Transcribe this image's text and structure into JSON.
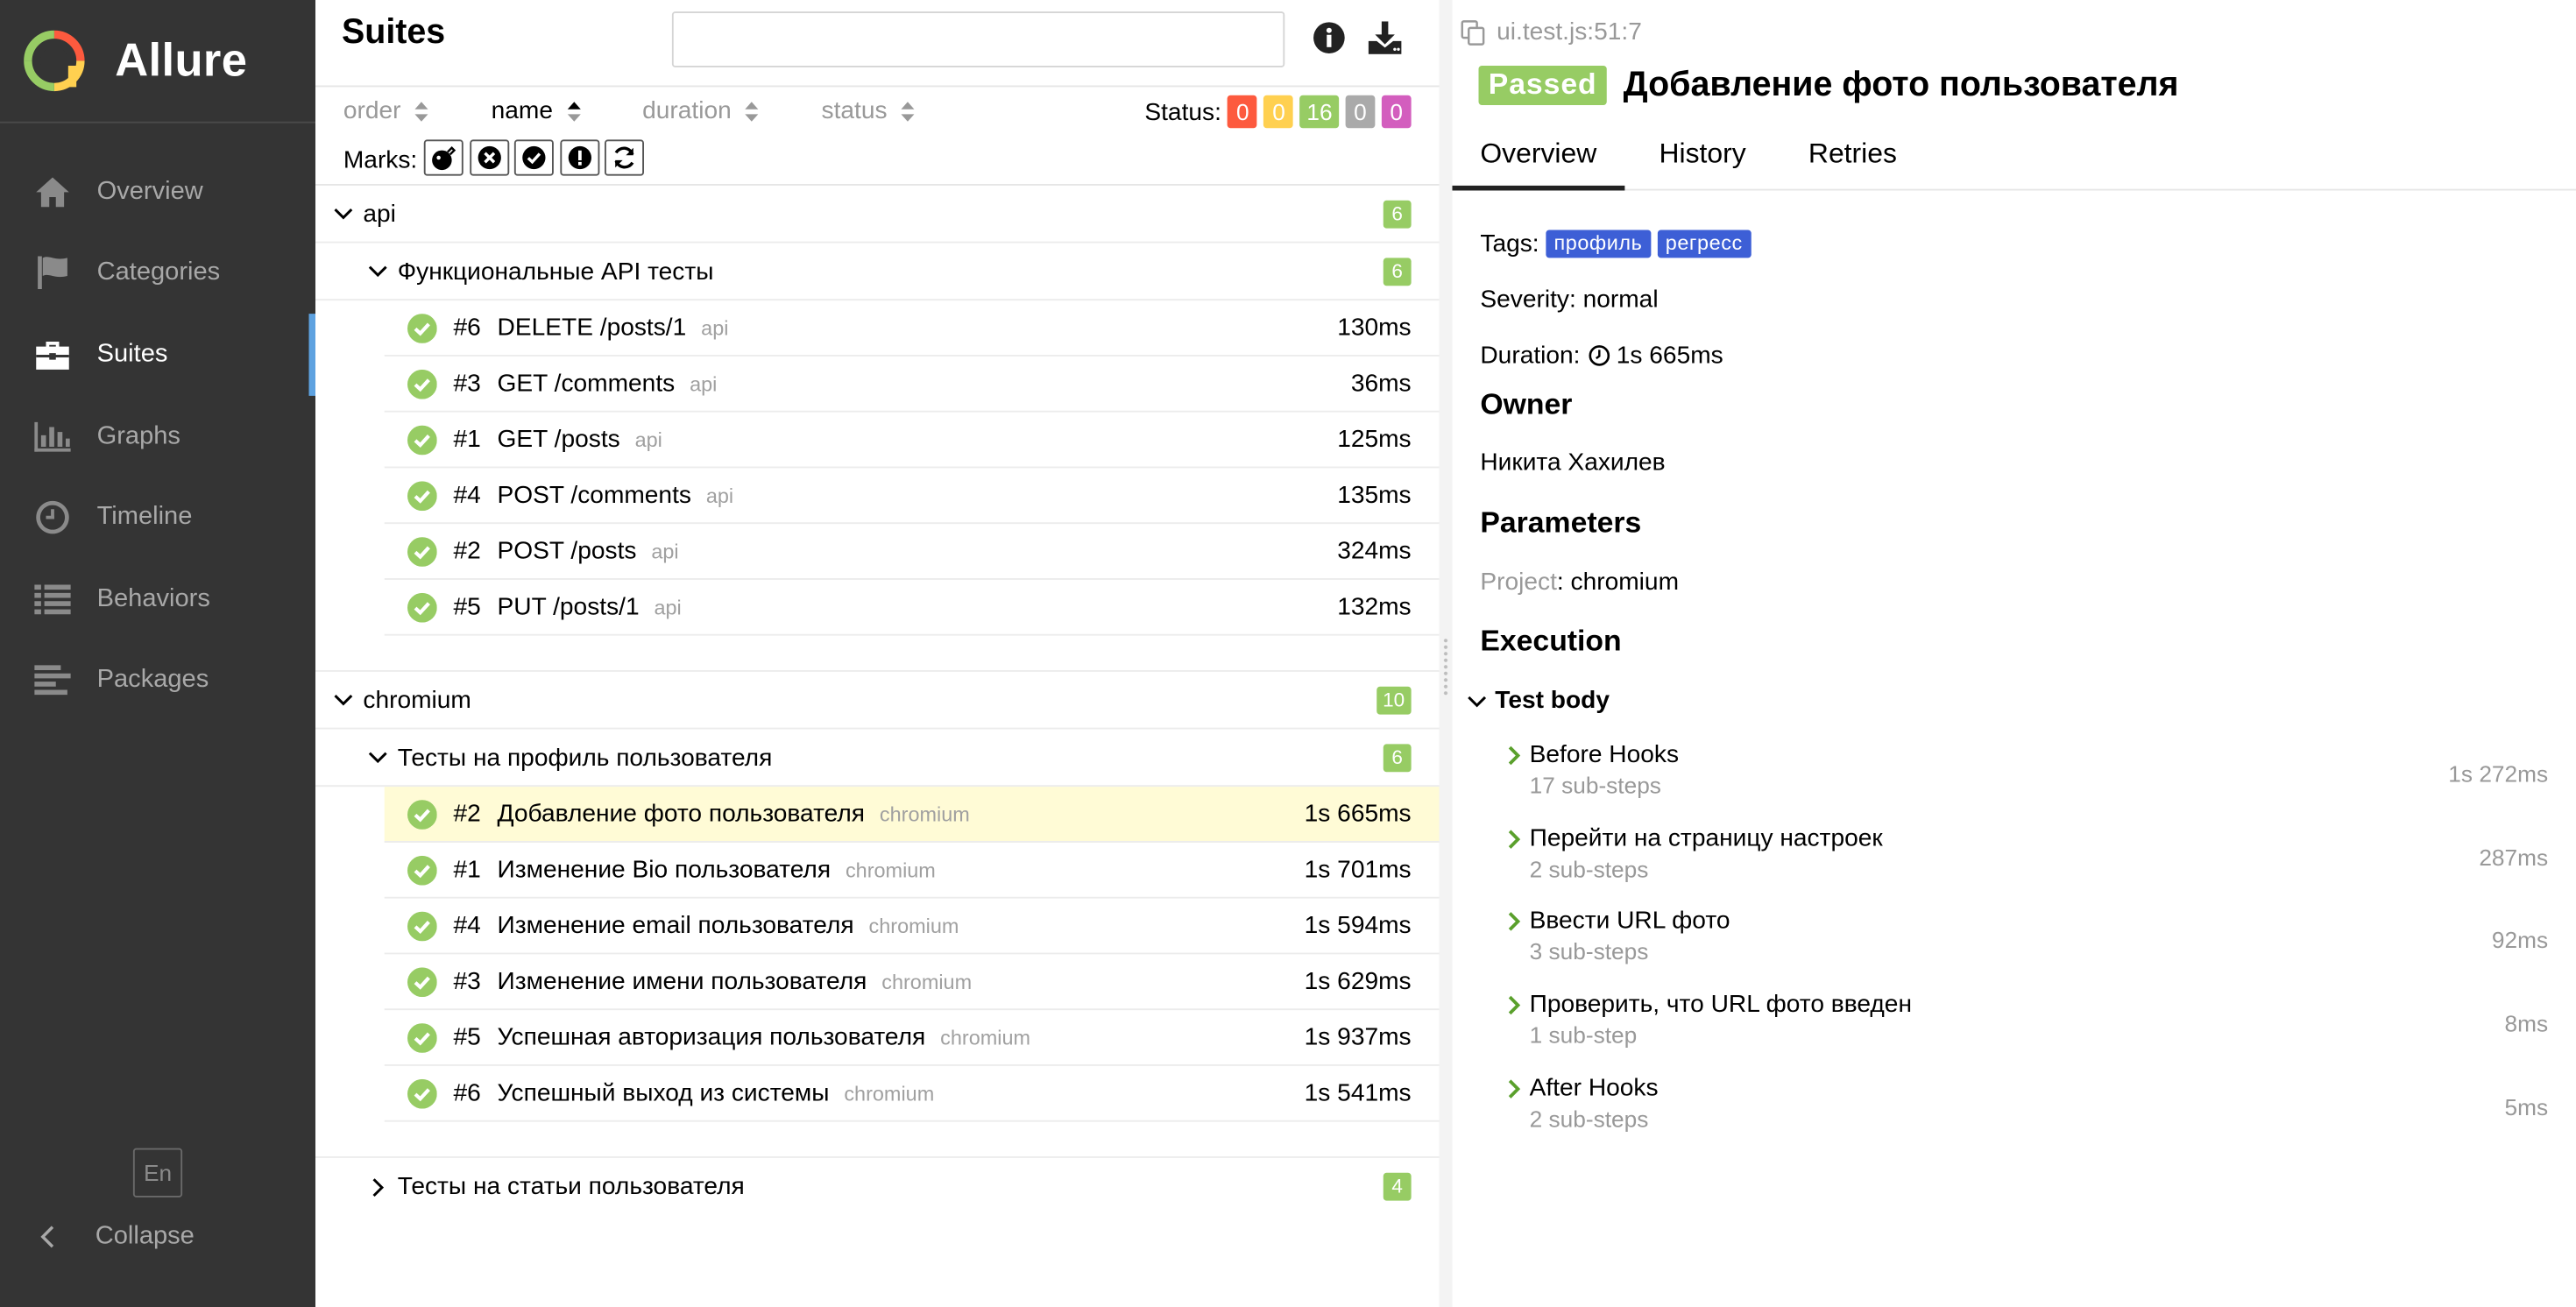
{
  "app": {
    "name": "Allure",
    "nav": [
      {
        "label": "Overview",
        "icon": "home-icon"
      },
      {
        "label": "Categories",
        "icon": "flag-icon"
      },
      {
        "label": "Suites",
        "icon": "briefcase-icon",
        "active": true
      },
      {
        "label": "Graphs",
        "icon": "bar-chart-icon"
      },
      {
        "label": "Timeline",
        "icon": "clock-icon"
      },
      {
        "label": "Behaviors",
        "icon": "list-icon"
      },
      {
        "label": "Packages",
        "icon": "align-left-icon"
      }
    ],
    "language": "En",
    "collapse_label": "Collapse"
  },
  "suites": {
    "title": "Suites",
    "search_value": "",
    "sort": {
      "order": "order",
      "name": "name",
      "duration": "duration",
      "status": "status"
    },
    "status_label": "Status:",
    "status_counts": [
      {
        "value": "0",
        "color": "#fd5a3e",
        "name": "failed"
      },
      {
        "value": "0",
        "color": "#ffd050",
        "name": "broken"
      },
      {
        "value": "16",
        "color": "#97cc64",
        "name": "passed"
      },
      {
        "value": "0",
        "color": "#aaaaaa",
        "name": "skipped"
      },
      {
        "value": "0",
        "color": "#d35ebe",
        "name": "unknown"
      }
    ],
    "marks_label": "Marks:",
    "groups": [
      {
        "name": "api",
        "count": "6",
        "subgroups": [
          {
            "name": "Функциональные API тесты",
            "count": "6",
            "expanded": true,
            "tests": [
              {
                "num": "#6",
                "name": "DELETE /posts/1",
                "tag": "api",
                "duration": "130ms"
              },
              {
                "num": "#3",
                "name": "GET /comments",
                "tag": "api",
                "duration": "36ms"
              },
              {
                "num": "#1",
                "name": "GET /posts",
                "tag": "api",
                "duration": "125ms"
              },
              {
                "num": "#4",
                "name": "POST /comments",
                "tag": "api",
                "duration": "135ms"
              },
              {
                "num": "#2",
                "name": "POST /posts",
                "tag": "api",
                "duration": "324ms"
              },
              {
                "num": "#5",
                "name": "PUT /posts/1",
                "tag": "api",
                "duration": "132ms"
              }
            ]
          }
        ]
      },
      {
        "name": "chromium",
        "count": "10",
        "subgroups": [
          {
            "name": "Тесты на профиль пользователя",
            "count": "6",
            "expanded": true,
            "tests": [
              {
                "num": "#2",
                "name": "Добавление фото пользователя",
                "tag": "chromium",
                "duration": "1s 665ms",
                "selected": true
              },
              {
                "num": "#1",
                "name": "Изменение Bio пользователя",
                "tag": "chromium",
                "duration": "1s 701ms"
              },
              {
                "num": "#4",
                "name": "Изменение email пользователя",
                "tag": "chromium",
                "duration": "1s 594ms"
              },
              {
                "num": "#3",
                "name": "Изменение имени пользователя",
                "tag": "chromium",
                "duration": "1s 629ms"
              },
              {
                "num": "#5",
                "name": "Успешная авторизация пользователя",
                "tag": "chromium",
                "duration": "1s 937ms"
              },
              {
                "num": "#6",
                "name": "Успешный выход из системы",
                "tag": "chromium",
                "duration": "1s 541ms"
              }
            ]
          },
          {
            "name": "Тесты на статьи пользователя",
            "count": "4",
            "expanded": false,
            "tests": []
          }
        ]
      }
    ]
  },
  "details": {
    "path": "ui.test.js:51:7",
    "status_label": "Passed",
    "title": "Добавление фото пользователя",
    "tabs": [
      "Overview",
      "History",
      "Retries"
    ],
    "tags_label": "Tags:",
    "tags": [
      "профиль",
      "регресс"
    ],
    "severity": "Severity: normal",
    "duration_label": "Duration:",
    "duration": "1s 665ms",
    "owner_heading": "Owner",
    "owner": "Никита Хахилев",
    "parameters_heading": "Parameters",
    "param_key": "Project",
    "param_value": ": chromium",
    "execution_heading": "Execution",
    "test_body_label": "Test body",
    "steps": [
      {
        "title": "Before Hooks",
        "sub": "17 sub-steps",
        "duration": "1s 272ms"
      },
      {
        "title": "Перейти на страницу настроек",
        "sub": "2 sub-steps",
        "duration": "287ms"
      },
      {
        "title": "Ввести URL фото",
        "sub": "3 sub-steps",
        "duration": "92ms"
      },
      {
        "title": "Проверить, что URL фото введен",
        "sub": "1 sub-step",
        "duration": "8ms"
      },
      {
        "title": "After Hooks",
        "sub": "2 sub-steps",
        "duration": "5ms"
      }
    ]
  }
}
